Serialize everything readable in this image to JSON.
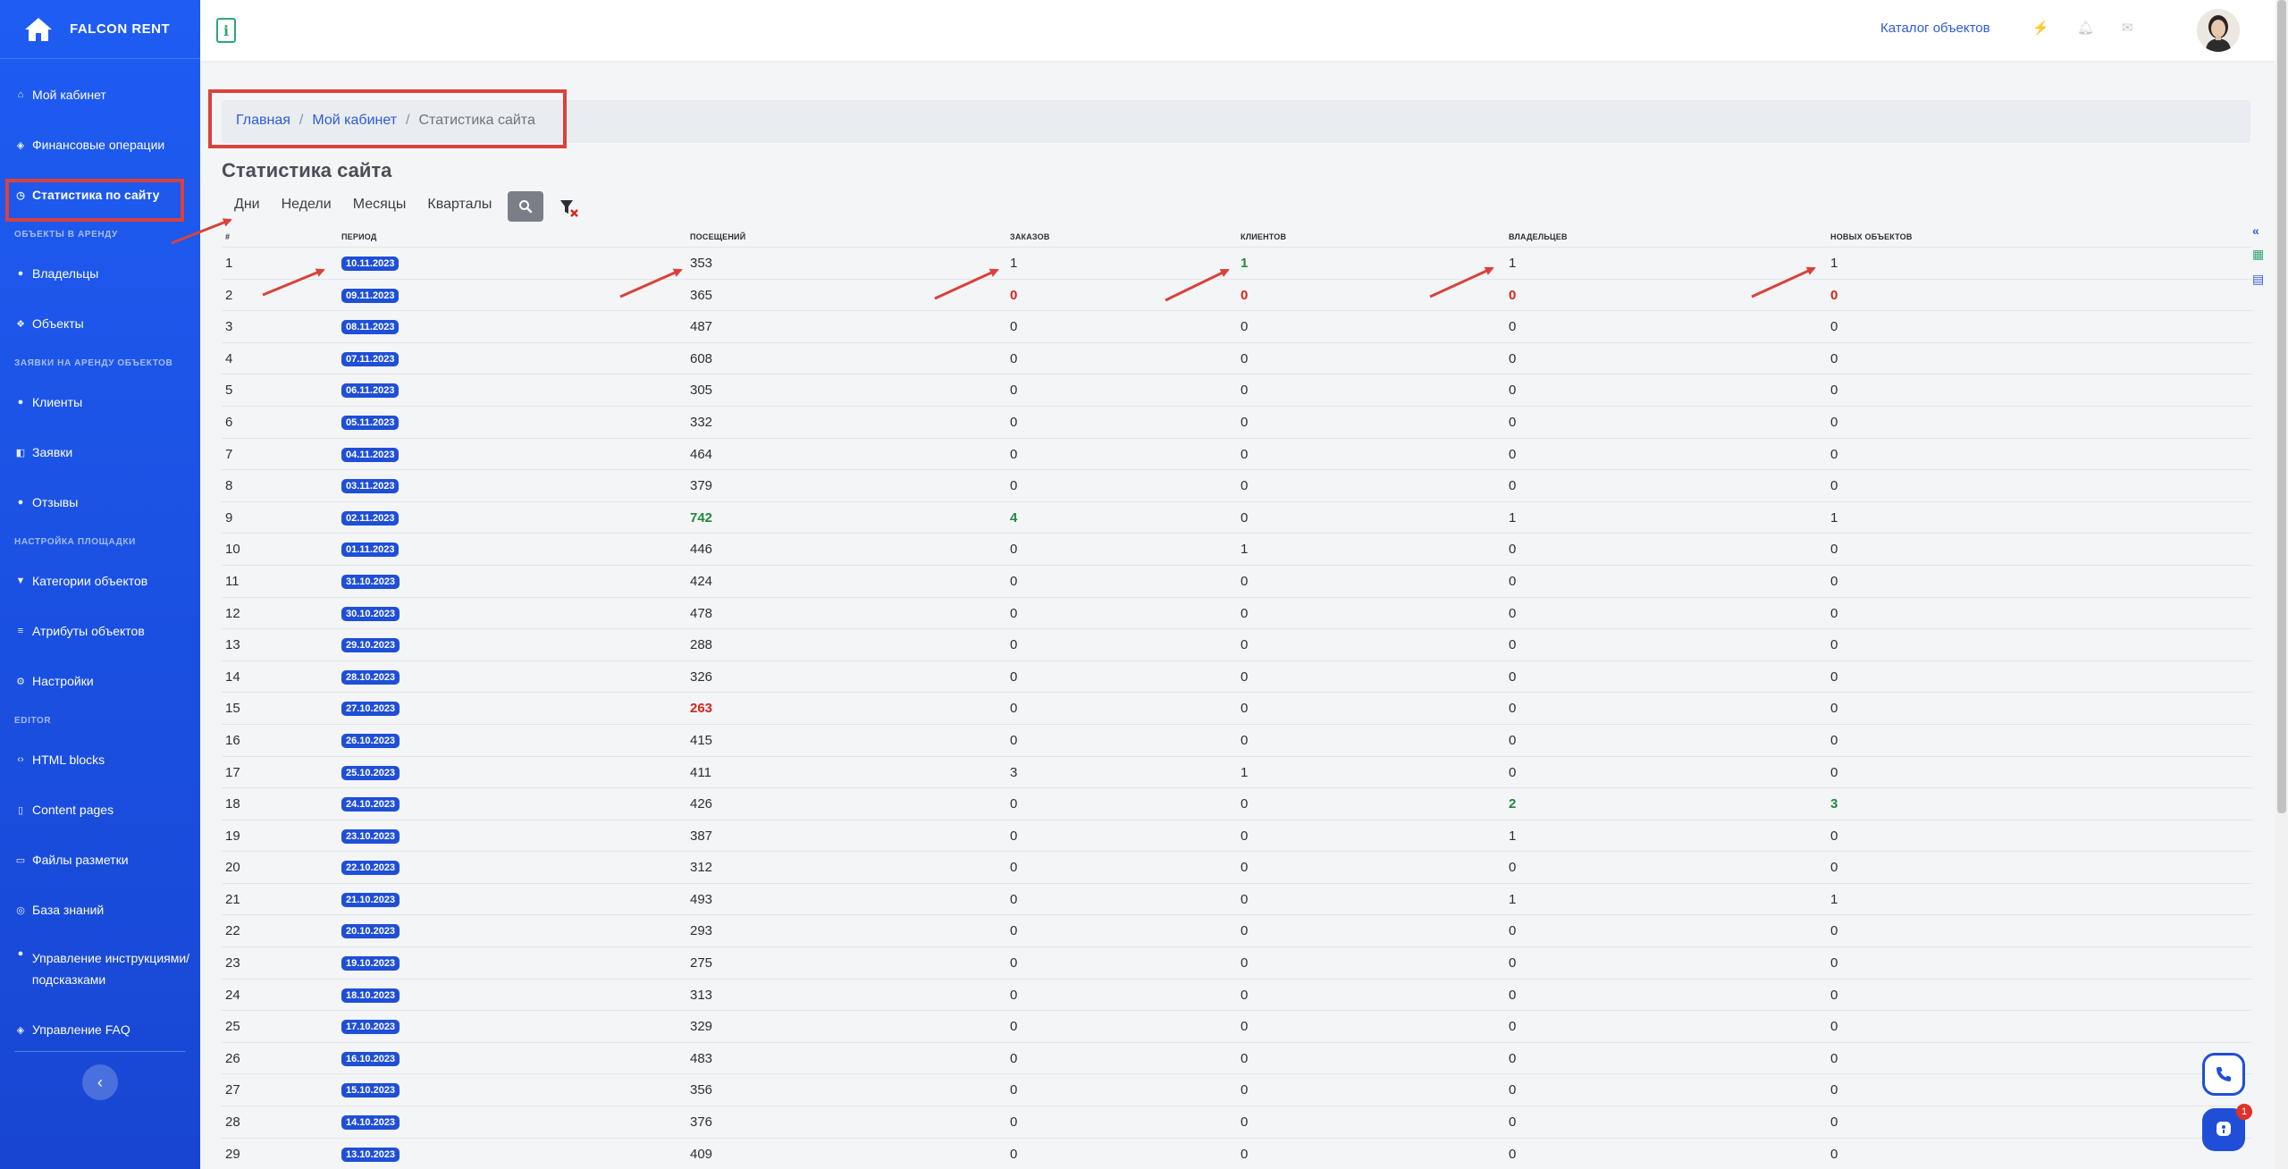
{
  "brand": {
    "name": "FALCON RENT"
  },
  "sidebar": {
    "items": [
      {
        "type": "item",
        "label": "Мой кабинет",
        "icon": "home-icon"
      },
      {
        "type": "item",
        "label": "Финансовые операции",
        "icon": "shield-icon"
      },
      {
        "type": "item",
        "label": "Статистика по сайту",
        "icon": "clock-icon",
        "active": true
      },
      {
        "type": "section",
        "label": "Объекты в аренду"
      },
      {
        "type": "item",
        "label": "Владельцы",
        "icon": "user-icon"
      },
      {
        "type": "item",
        "label": "Объекты",
        "icon": "cubes-icon"
      },
      {
        "type": "section",
        "label": "Заявки на аренду объектов"
      },
      {
        "type": "item",
        "label": "Клиенты",
        "icon": "users-icon"
      },
      {
        "type": "item",
        "label": "Заявки",
        "icon": "layers-icon"
      },
      {
        "type": "item",
        "label": "Отзывы",
        "icon": "user-icon"
      },
      {
        "type": "section",
        "label": "Настройка площадки"
      },
      {
        "type": "item",
        "label": "Категории объектов",
        "icon": "filter-icon"
      },
      {
        "type": "item",
        "label": "Атрибуты объектов",
        "icon": "list-icon"
      },
      {
        "type": "item",
        "label": "Настройки",
        "icon": "gear-icon"
      },
      {
        "type": "section",
        "label": "Editor"
      },
      {
        "type": "item",
        "label": "HTML blocks",
        "icon": "code-icon"
      },
      {
        "type": "item",
        "label": "Content pages",
        "icon": "file-icon"
      },
      {
        "type": "item",
        "label": "Файлы разметки",
        "icon": "folder-icon"
      },
      {
        "type": "item",
        "label": "База знаний",
        "icon": "database-icon"
      },
      {
        "type": "item",
        "label": "Управление инструкциями/подсказками",
        "icon": "user-icon",
        "two_line": true
      },
      {
        "type": "item",
        "label": "Управление FAQ",
        "icon": "shield-icon"
      }
    ]
  },
  "topbar": {
    "info_label": "i",
    "catalog_link": "Каталог объектов",
    "icons": [
      "bolt-icon",
      "bell-icon",
      "envelope-icon"
    ]
  },
  "breadcrumb": {
    "home": "Главная",
    "cabinet": "Мой кабинет",
    "current": "Статистика сайта"
  },
  "page_title": "Статистика сайта",
  "period_tabs": [
    "Дни",
    "Недели",
    "Месяцы",
    "Кварталы"
  ],
  "table": {
    "headers": [
      "#",
      "Период",
      "Посещений",
      "Заказов",
      "Клиентов",
      "Владельцев",
      "Новых объектов"
    ],
    "rows": [
      {
        "n": "1",
        "period": "10.11.2023",
        "visits": "353",
        "orders": "1",
        "clients": "1",
        "owners": "1",
        "objects": "1",
        "styles": {
          "clients": "green"
        }
      },
      {
        "n": "2",
        "period": "09.11.2023",
        "visits": "365",
        "orders": "0",
        "clients": "0",
        "owners": "0",
        "objects": "0",
        "styles": {
          "orders": "red",
          "clients": "red",
          "owners": "red",
          "objects": "red"
        }
      },
      {
        "n": "3",
        "period": "08.11.2023",
        "visits": "487",
        "orders": "0",
        "clients": "0",
        "owners": "0",
        "objects": "0"
      },
      {
        "n": "4",
        "period": "07.11.2023",
        "visits": "608",
        "orders": "0",
        "clients": "0",
        "owners": "0",
        "objects": "0"
      },
      {
        "n": "5",
        "period": "06.11.2023",
        "visits": "305",
        "orders": "0",
        "clients": "0",
        "owners": "0",
        "objects": "0"
      },
      {
        "n": "6",
        "period": "05.11.2023",
        "visits": "332",
        "orders": "0",
        "clients": "0",
        "owners": "0",
        "objects": "0"
      },
      {
        "n": "7",
        "period": "04.11.2023",
        "visits": "464",
        "orders": "0",
        "clients": "0",
        "owners": "0",
        "objects": "0"
      },
      {
        "n": "8",
        "period": "03.11.2023",
        "visits": "379",
        "orders": "0",
        "clients": "0",
        "owners": "0",
        "objects": "0"
      },
      {
        "n": "9",
        "period": "02.11.2023",
        "visits": "742",
        "orders": "4",
        "clients": "0",
        "owners": "1",
        "objects": "1",
        "styles": {
          "visits": "green",
          "orders": "green"
        }
      },
      {
        "n": "10",
        "period": "01.11.2023",
        "visits": "446",
        "orders": "0",
        "clients": "1",
        "owners": "0",
        "objects": "0"
      },
      {
        "n": "11",
        "period": "31.10.2023",
        "visits": "424",
        "orders": "0",
        "clients": "0",
        "owners": "0",
        "objects": "0"
      },
      {
        "n": "12",
        "period": "30.10.2023",
        "visits": "478",
        "orders": "0",
        "clients": "0",
        "owners": "0",
        "objects": "0"
      },
      {
        "n": "13",
        "period": "29.10.2023",
        "visits": "288",
        "orders": "0",
        "clients": "0",
        "owners": "0",
        "objects": "0"
      },
      {
        "n": "14",
        "period": "28.10.2023",
        "visits": "326",
        "orders": "0",
        "clients": "0",
        "owners": "0",
        "objects": "0"
      },
      {
        "n": "15",
        "period": "27.10.2023",
        "visits": "263",
        "orders": "0",
        "clients": "0",
        "owners": "0",
        "objects": "0",
        "styles": {
          "visits": "red"
        }
      },
      {
        "n": "16",
        "period": "26.10.2023",
        "visits": "415",
        "orders": "0",
        "clients": "0",
        "owners": "0",
        "objects": "0"
      },
      {
        "n": "17",
        "period": "25.10.2023",
        "visits": "411",
        "orders": "3",
        "clients": "1",
        "owners": "0",
        "objects": "0"
      },
      {
        "n": "18",
        "period": "24.10.2023",
        "visits": "426",
        "orders": "0",
        "clients": "0",
        "owners": "2",
        "objects": "3",
        "styles": {
          "owners": "green",
          "objects": "green"
        }
      },
      {
        "n": "19",
        "period": "23.10.2023",
        "visits": "387",
        "orders": "0",
        "clients": "0",
        "owners": "1",
        "objects": "0"
      },
      {
        "n": "20",
        "period": "22.10.2023",
        "visits": "312",
        "orders": "0",
        "clients": "0",
        "owners": "0",
        "objects": "0"
      },
      {
        "n": "21",
        "period": "21.10.2023",
        "visits": "493",
        "orders": "0",
        "clients": "0",
        "owners": "1",
        "objects": "1"
      },
      {
        "n": "22",
        "period": "20.10.2023",
        "visits": "293",
        "orders": "0",
        "clients": "0",
        "owners": "0",
        "objects": "0"
      },
      {
        "n": "23",
        "period": "19.10.2023",
        "visits": "275",
        "orders": "0",
        "clients": "0",
        "owners": "0",
        "objects": "0"
      },
      {
        "n": "24",
        "period": "18.10.2023",
        "visits": "313",
        "orders": "0",
        "clients": "0",
        "owners": "0",
        "objects": "0"
      },
      {
        "n": "25",
        "period": "17.10.2023",
        "visits": "329",
        "orders": "0",
        "clients": "0",
        "owners": "0",
        "objects": "0"
      },
      {
        "n": "26",
        "period": "16.10.2023",
        "visits": "483",
        "orders": "0",
        "clients": "0",
        "owners": "0",
        "objects": "0"
      },
      {
        "n": "27",
        "period": "15.10.2023",
        "visits": "356",
        "orders": "0",
        "clients": "0",
        "owners": "0",
        "objects": "0"
      },
      {
        "n": "28",
        "period": "14.10.2023",
        "visits": "376",
        "orders": "0",
        "clients": "0",
        "owners": "0",
        "objects": "0"
      },
      {
        "n": "29",
        "period": "13.10.2023",
        "visits": "409",
        "orders": "0",
        "clients": "0",
        "owners": "0",
        "objects": "0"
      }
    ]
  },
  "chat_widget": {
    "badge": "1"
  },
  "colors": {
    "sidebar": "#1f5cf2",
    "badge": "#1f4fd6",
    "red": "#d9231c",
    "green": "#1f8a3b",
    "annotation": "#d9423b"
  }
}
